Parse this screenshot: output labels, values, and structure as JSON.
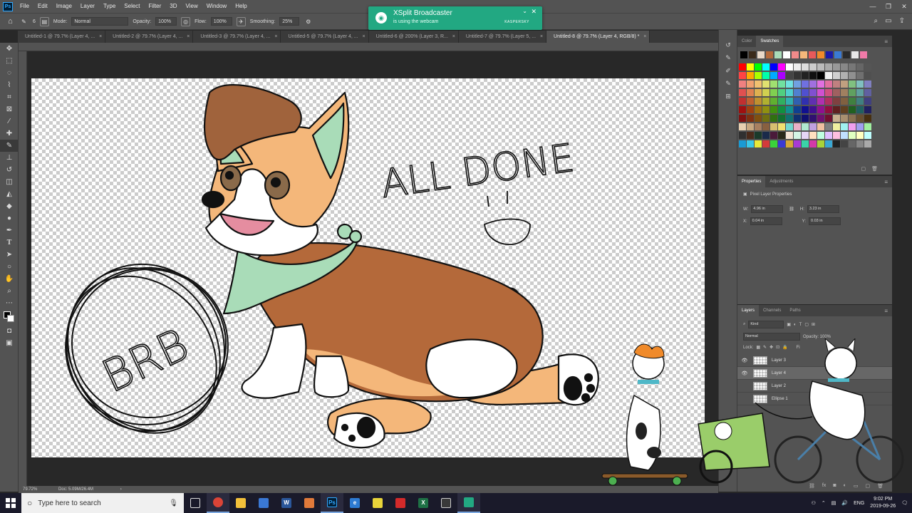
{
  "menubar": {
    "app_logo": "Ps",
    "items": [
      "File",
      "Edit",
      "Image",
      "Layer",
      "Type",
      "Select",
      "Filter",
      "3D",
      "View",
      "Window",
      "Help"
    ]
  },
  "options": {
    "brush_size": "6",
    "mode_label": "Mode:",
    "mode_value": "Normal",
    "opacity_label": "Opacity:",
    "opacity_value": "100%",
    "flow_label": "Flow:",
    "flow_value": "100%",
    "smoothing_label": "Smoothing:",
    "smoothing_value": "25%"
  },
  "toast": {
    "title": "XSplit Broadcaster",
    "subtitle": "is using the webcam",
    "brand": "KASPERSKY"
  },
  "tabs": [
    {
      "label": "Untitled-1 @ 79.7% (Layer 4, ...",
      "active": false
    },
    {
      "label": "Untitled-2 @ 79.7% (Layer 4, ...",
      "active": false
    },
    {
      "label": "Untitled-3 @ 79.7% (Layer 4, ...",
      "active": false
    },
    {
      "label": "Untitled-5 @ 79.7% (Layer 4, ...",
      "active": false
    },
    {
      "label": "Untitled-6 @ 200% (Layer 3, R...",
      "active": false
    },
    {
      "label": "Untitled-7 @ 79.7% (Layer 5, ...",
      "active": false
    },
    {
      "label": "Untitled-8 @ 79.7% (Layer 4, RGB/8) *",
      "active": true
    }
  ],
  "canvas": {
    "text_done": "ALL DONE",
    "text_brb": "BRB"
  },
  "status": {
    "zoom": "79.72%",
    "doc": "Doc: 5.09M/26.4M"
  },
  "color_panel": {
    "tabs": [
      "Color",
      "Swatches"
    ],
    "active_tab": "Swatches"
  },
  "properties_panel": {
    "tabs": [
      "Properties",
      "Adjustments"
    ],
    "title": "Pixel Layer Properties",
    "w_label": "W:",
    "w_value": "4.96 in",
    "h_label": "H:",
    "h_value": "3.23 in",
    "x_label": "X:",
    "x_value": "0.04 in",
    "y_label": "Y:",
    "y_value": "0.03 in"
  },
  "layers_panel": {
    "tabs": [
      "Layers",
      "Channels",
      "Paths"
    ],
    "kind_label": "Kind",
    "blend_mode": "Normal",
    "opacity_label": "Opacity: 100%",
    "lock_label": "Lock:",
    "fill_label": "Fi",
    "layers": [
      {
        "name": "Layer 3",
        "visible": true,
        "selected": false
      },
      {
        "name": "Layer 4",
        "visible": true,
        "selected": true
      },
      {
        "name": "Layer 2",
        "visible": false,
        "selected": false
      },
      {
        "name": "Ellipse 1",
        "visible": false,
        "selected": false
      }
    ]
  },
  "taskbar": {
    "search_placeholder": "Type here to search",
    "lang": "ENG",
    "time": "9:02 PM",
    "date": "2019-09-26"
  },
  "colors": {
    "toast_bg": "#22a882",
    "ui_panel": "#535353",
    "ui_dark": "#282828",
    "corgi_brown": "#b4693a",
    "corgi_tan": "#f4b77a",
    "corgi_hair": "#a0633c",
    "bandana_green": "#a9dcb8"
  }
}
